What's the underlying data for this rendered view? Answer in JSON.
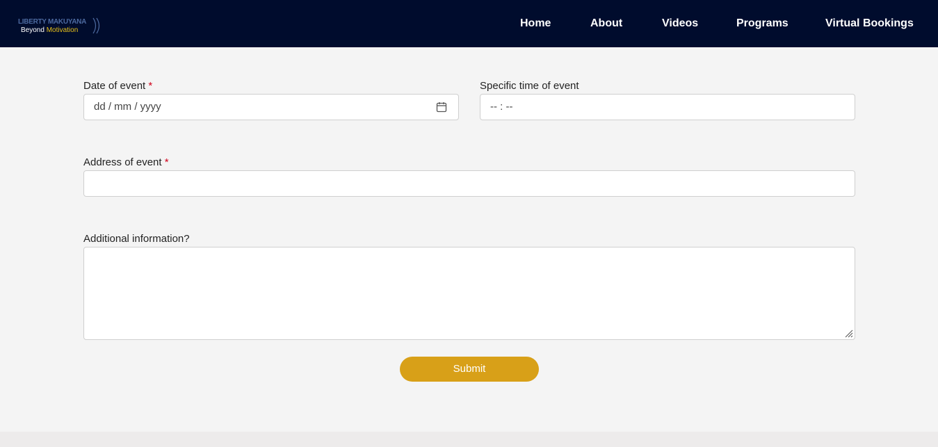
{
  "header": {
    "logo": {
      "top_text": "LIBERTY MAKUYANA",
      "bottom_text_plain": "Beyond",
      "bottom_text_accent": "Motivation"
    },
    "nav": [
      {
        "label": "Home"
      },
      {
        "label": "About"
      },
      {
        "label": "Videos"
      },
      {
        "label": "Programs"
      },
      {
        "label": "Virtual Bookings"
      }
    ]
  },
  "form": {
    "date_label": "Date of event",
    "date_placeholder": "dd / mm / yyyy",
    "time_label": "Specific time of event",
    "time_placeholder": "-- : --",
    "address_label": "Address of event",
    "address_value": "",
    "additional_label": "Additional information?",
    "additional_value": "",
    "required_marker": "*",
    "submit_label": "Submit"
  },
  "colors": {
    "header_bg": "#000c2d",
    "accent": "#d8a018",
    "required": "#d0021b",
    "page_bg": "#f4f4f4"
  },
  "icons": [
    "calendar-icon",
    "resize-handle-icon"
  ]
}
